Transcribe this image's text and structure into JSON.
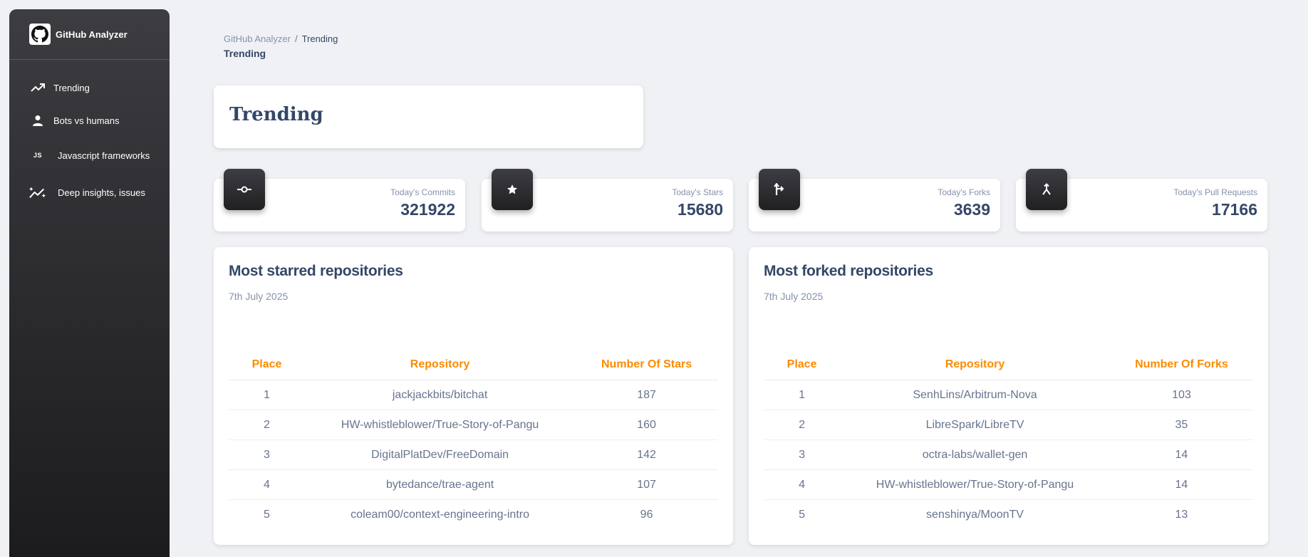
{
  "app": {
    "name": "GitHub Analyzer"
  },
  "sidebar": {
    "items": [
      {
        "label": "Trending",
        "icon": "trending-up-icon"
      },
      {
        "label": "Bots vs humans",
        "icon": "person-icon"
      },
      {
        "label": "Javascript frameworks",
        "icon": "js-icon",
        "icon_text": "JS"
      },
      {
        "label": "Deep insights, issues",
        "icon": "insights-icon"
      }
    ]
  },
  "breadcrumb": {
    "root": "GitHub Analyzer",
    "separator": "/",
    "current": "Trending",
    "title": "Trending"
  },
  "page": {
    "title": "Trending"
  },
  "stats": [
    {
      "label": "Today's Commits",
      "value": "321922",
      "icon": "commit-icon"
    },
    {
      "label": "Today's Stars",
      "value": "15680",
      "icon": "star-icon"
    },
    {
      "label": "Today's Forks",
      "value": "3639",
      "icon": "fork-icon"
    },
    {
      "label": "Today's Pull Requests",
      "value": "17166",
      "icon": "merge-icon"
    }
  ],
  "starred": {
    "title": "Most starred repositories",
    "date": "7th July 2025",
    "headers": [
      "Place",
      "Repository",
      "Number Of Stars"
    ],
    "rows": [
      [
        "1",
        "jackjackbits/bitchat",
        "187"
      ],
      [
        "2",
        "HW-whistleblower/True-Story-of-Pangu",
        "160"
      ],
      [
        "3",
        "DigitalPlatDev/FreeDomain",
        "142"
      ],
      [
        "4",
        "bytedance/trae-agent",
        "107"
      ],
      [
        "5",
        "coleam00/context-engineering-intro",
        "96"
      ]
    ]
  },
  "forked": {
    "title": "Most forked repositories",
    "date": "7th July 2025",
    "headers": [
      "Place",
      "Repository",
      "Number Of Forks"
    ],
    "rows": [
      [
        "1",
        "SenhLins/Arbitrum-Nova",
        "103"
      ],
      [
        "2",
        "LibreSpark/LibreTV",
        "35"
      ],
      [
        "3",
        "octra-labs/wallet-gen",
        "14"
      ],
      [
        "4",
        "HW-whistleblower/True-Story-of-Pangu",
        "14"
      ],
      [
        "5",
        "senshinya/MoonTV",
        "13"
      ]
    ]
  },
  "colors": {
    "accent_orange": "#fb8c00",
    "heading": "#344767",
    "muted": "#8392ab"
  }
}
